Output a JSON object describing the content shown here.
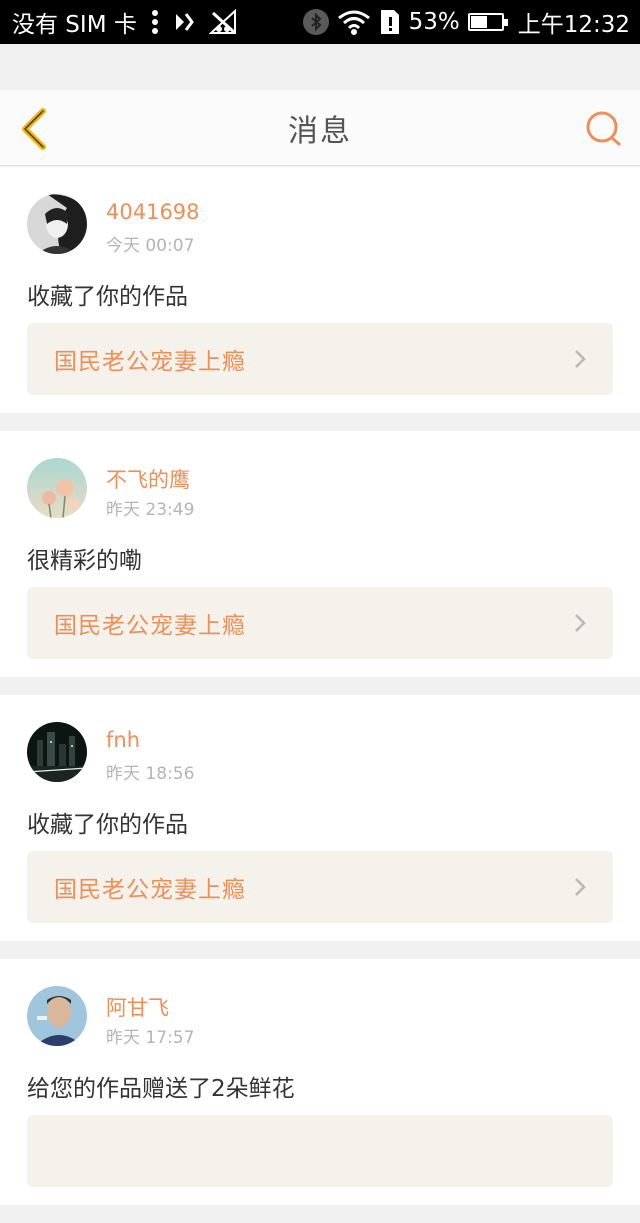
{
  "status_bar": {
    "carrier": "没有 SIM 卡",
    "battery": "53%",
    "battery_level": 0.53,
    "time": "上午12:32",
    "icons": [
      "menu-dots-icon",
      "data-toggle-icon",
      "no-signal-icon",
      "bluetooth-icon",
      "wifi-icon",
      "sim-alert-icon",
      "battery-icon"
    ]
  },
  "header": {
    "title": "消息",
    "back_icon": "chevron-left-icon",
    "search_icon": "search-icon",
    "accent": "#f5b400",
    "search_color": "#f08e57"
  },
  "messages": [
    {
      "username": "4041698",
      "time": "今天 00:07",
      "action": "收藏了你的作品",
      "work": "国民老公宠妻上瘾",
      "avatar": "dark-portrait-avatar"
    },
    {
      "username": "不飞的鹰",
      "time": "昨天 23:49",
      "action": "很精彩的嘞",
      "work": "国民老公宠妻上瘾",
      "avatar": "flower-avatar"
    },
    {
      "username": "fnh",
      "time": "昨天 18:56",
      "action": "收藏了你的作品",
      "work": "国民老公宠妻上瘾",
      "avatar": "city-night-avatar"
    },
    {
      "username": "阿甘飞",
      "time": "昨天 17:57",
      "action": "给您的作品赠送了2朵鲜花",
      "work": "",
      "avatar": "man-portrait-avatar"
    }
  ],
  "colors": {
    "username": "#f08e57",
    "work_title": "#f08e57",
    "work_box_bg": "#f5f2ec",
    "page_bg": "#f1f1f1"
  }
}
